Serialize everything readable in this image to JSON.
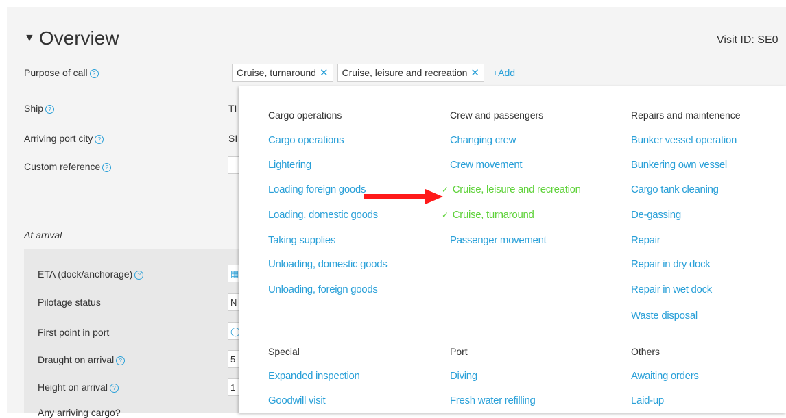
{
  "overview": {
    "title": "Overview",
    "visit_id": "Visit ID: SE0"
  },
  "form": {
    "purpose_label": "Purpose of call",
    "purpose_tags": [
      "Cruise, turnaround",
      "Cruise, leisure and recreation"
    ],
    "add_label": "+Add",
    "ship_label": "Ship",
    "ship_value": "TI",
    "arriving_label": "Arriving port city",
    "arriving_value": "SI",
    "custom_ref_label": "Custom reference"
  },
  "arrival": {
    "heading": "At arrival",
    "eta_label": "ETA (dock/anchorage)",
    "pilotage_label": "Pilotage status",
    "pilotage_value": "N",
    "first_point_label": "First point in port",
    "draught_label": "Draught on arrival",
    "draught_value": "5",
    "height_label": "Height on arrival",
    "height_value": "1",
    "cargo_label": "Any arriving cargo?"
  },
  "menu": {
    "cargo": {
      "heading": "Cargo operations",
      "items": [
        "Cargo operations",
        "Lightering",
        "Loading foreign goods",
        "Loading, domestic goods",
        "Taking supplies",
        "Unloading, domestic goods",
        "Unloading, foreign goods"
      ]
    },
    "crew": {
      "heading": "Crew and passengers",
      "items": [
        "Changing crew",
        "Crew movement",
        "Cruise, leisure and recreation",
        "Cruise, turnaround",
        "Passenger movement"
      ],
      "selected": [
        false,
        false,
        true,
        true,
        false
      ]
    },
    "repairs": {
      "heading": "Repairs and maintenence",
      "items": [
        "Bunker vessel operation",
        "Bunkering own vessel",
        "Cargo tank cleaning",
        "De-gassing",
        "Repair",
        "Repair in dry dock",
        "Repair in wet dock",
        "Waste disposal"
      ]
    },
    "special": {
      "heading": "Special",
      "items": [
        "Expanded inspection",
        "Goodwill visit"
      ]
    },
    "port": {
      "heading": "Port",
      "items": [
        "Diving",
        "Fresh water refilling"
      ]
    },
    "others": {
      "heading": "Others",
      "items": [
        "Awaiting orders",
        "Laid-up"
      ]
    }
  },
  "colors": {
    "link": "#2aa0d8",
    "selected": "#5fd23a",
    "arrow": "#ff1a1a"
  },
  "icons": {
    "help": "question-circle",
    "remove": "x",
    "check": "checkmark",
    "collapse": "triangle-down"
  }
}
